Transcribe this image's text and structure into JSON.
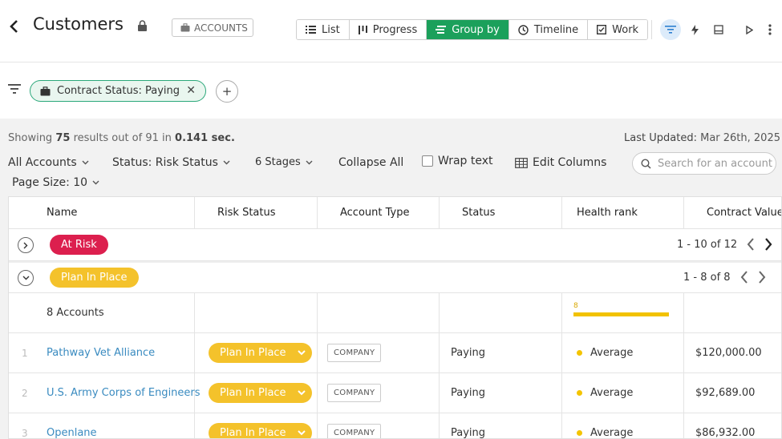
{
  "header": {
    "title": "Customers",
    "badge": "ACCOUNTS",
    "views": [
      {
        "label": "List",
        "icon": "list-icon",
        "active": false
      },
      {
        "label": "Progress",
        "icon": "progress-icon",
        "active": false
      },
      {
        "label": "Group by",
        "icon": "group-by-icon",
        "active": true
      },
      {
        "label": "Timeline",
        "icon": "clock-icon",
        "active": false
      },
      {
        "label": "Work",
        "icon": "checkbox-icon",
        "active": false
      }
    ]
  },
  "filters": {
    "chip_label": "Contract Status: Paying"
  },
  "summary": {
    "showing_prefix": "Showing",
    "count": "75",
    "mid": "results out of",
    "total": "91",
    "in_text": "in",
    "time": "0.141 sec.",
    "updated_label": "Last Updated:",
    "updated_value": "Mar 26th, 2025"
  },
  "controls": {
    "accounts": "All Accounts",
    "status": "Status: Risk Status",
    "stages": "6 Stages",
    "collapse": "Collapse All",
    "wrap": "Wrap text",
    "edit_columns": "Edit Columns",
    "search_placeholder": "Search for an account",
    "page_size": "Page Size: 10"
  },
  "table": {
    "columns": [
      "Name",
      "Risk Status",
      "Account Type",
      "Status",
      "Health rank",
      "Contract Value"
    ],
    "groups": [
      {
        "label": "At Risk",
        "pager": "1 - 10 of 12",
        "color": "#dc1f4e"
      },
      {
        "label": "Plan In Place",
        "pager": "1 - 8 of 8",
        "color": "#f4c22b"
      }
    ],
    "group_summary": {
      "accounts": "8 Accounts",
      "health_count": "8"
    },
    "rows": [
      {
        "num": "1",
        "name": "Pathway Vet Alliance",
        "risk": "Plan In Place",
        "type": "COMPANY",
        "status": "Paying",
        "health": "Average",
        "value": "$120,000.00"
      },
      {
        "num": "2",
        "name": "U.S. Army Corps of Engineers",
        "risk": "Plan In Place",
        "type": "COMPANY",
        "status": "Paying",
        "health": "Average",
        "value": "$92,689.00"
      },
      {
        "num": "3",
        "name": "Openlane",
        "risk": "Plan In Place",
        "type": "COMPANY",
        "status": "Paying",
        "health": "Average",
        "value": "$86,932.00"
      }
    ]
  }
}
